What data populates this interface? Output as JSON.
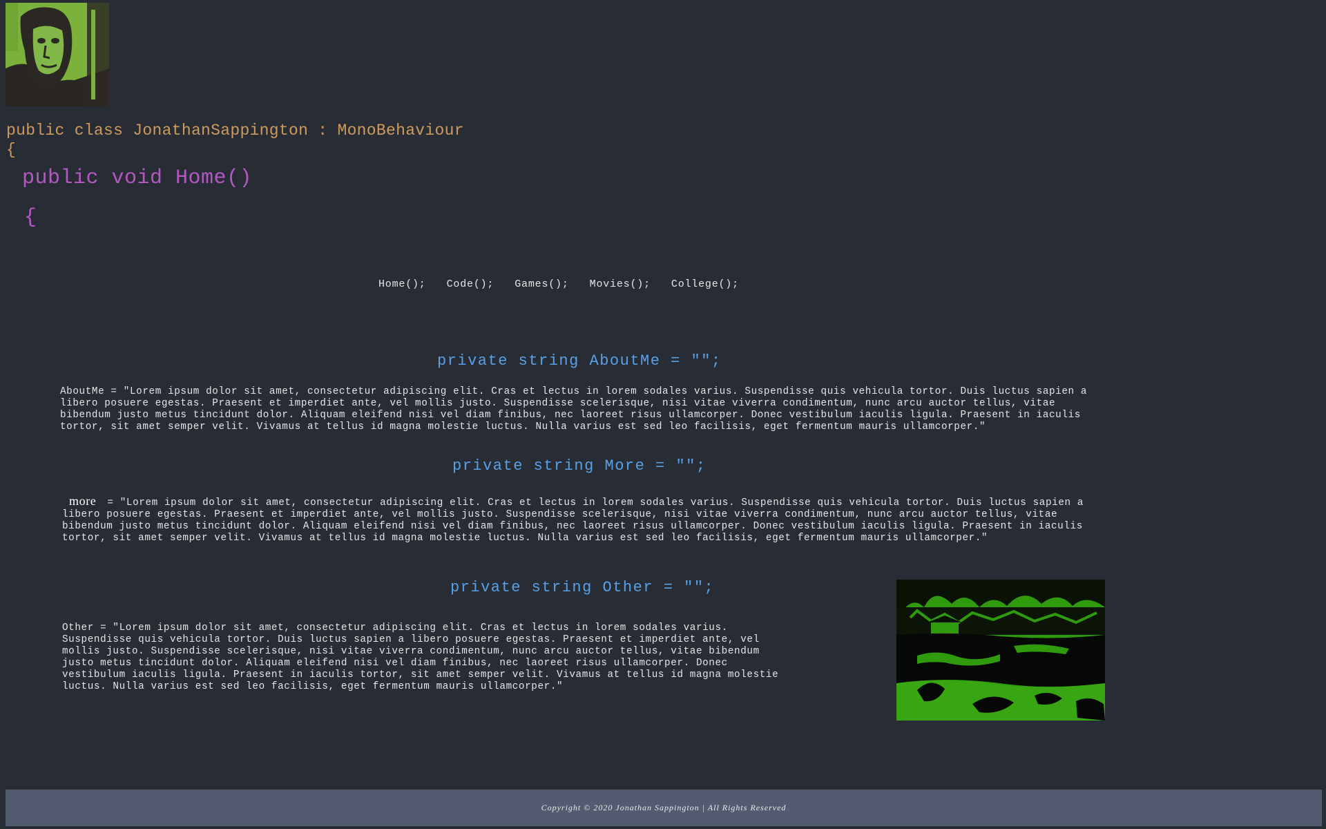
{
  "profile": {
    "avatar_icon": "portrait-photo-green"
  },
  "code": {
    "class_declaration": "public class JonathanSappington : MonoBehaviour",
    "class_open_brace": "{",
    "method_declaration": "public void Home()",
    "method_open_brace": "{"
  },
  "nav": {
    "items": [
      {
        "label": "Home();"
      },
      {
        "label": "Code();"
      },
      {
        "label": "Games();"
      },
      {
        "label": "Movies();"
      },
      {
        "label": "College();"
      }
    ]
  },
  "sections": {
    "about": {
      "heading": "private string AboutMe = \"\";",
      "text": "AboutMe = \"Lorem ipsum dolor sit amet, consectetur adipiscing elit. Cras et lectus in lorem sodales varius. Suspendisse quis vehicula tortor. Duis luctus sapien a libero posuere egestas. Praesent et imperdiet ante, vel mollis justo. Suspendisse scelerisque, nisi vitae viverra condimentum, nunc arcu auctor tellus, vitae bibendum justo metus tincidunt dolor. Aliquam eleifend nisi vel diam finibus, nec laoreet risus ullamcorper. Donec vestibulum iaculis ligula. Praesent in iaculis tortor, sit amet semper velit. Vivamus at tellus id magna molestie luctus. Nulla varius est sed leo facilisis, eget fermentum mauris ullamcorper.\""
    },
    "more": {
      "heading": "private string More = \"\";",
      "label": "more",
      "text": "= \"Lorem ipsum dolor sit amet, consectetur adipiscing elit. Cras et lectus in lorem sodales varius. Suspendisse quis vehicula tortor. Duis luctus sapien a libero posuere egestas. Praesent et imperdiet ante, vel mollis justo. Suspendisse scelerisque, nisi vitae viverra condimentum, nunc arcu auctor tellus, vitae bibendum justo metus tincidunt dolor. Aliquam eleifend nisi vel diam finibus, nec laoreet risus ullamcorper. Donec vestibulum iaculis ligula. Praesent in iaculis tortor, sit amet semper velit. Vivamus at tellus id magna molestie luctus. Nulla varius est sed leo facilisis, eget fermentum mauris ullamcorper.\""
    },
    "other": {
      "heading": "private string Other = \"\";",
      "text": "Other = \"Lorem ipsum dolor sit amet, consectetur adipiscing elit. Cras et lectus in lorem sodales varius. Suspendisse quis vehicula tortor. Duis luctus sapien a libero posuere egestas. Praesent et imperdiet ante, vel mollis justo. Suspendisse scelerisque, nisi vitae viverra condimentum, nunc arcu auctor tellus, vitae bibendum justo metus tincidunt dolor. Aliquam eleifend nisi vel diam finibus, nec laoreet risus ullamcorper. Donec vestibulum iaculis ligula. Praesent in iaculis tortor, sit amet semper velit. Vivamus at tellus id magna molestie luctus. Nulla varius est sed leo facilisis, eget fermentum mauris ullamcorper.\"",
      "image_icon": "park-pond-photo-green"
    }
  },
  "footer": {
    "copyright": "Copyright © 2020 Jonathan Sappington | All Rights Reserved"
  },
  "colors": {
    "background": "#272c35",
    "class_text": "#cf9a5b",
    "method_text": "#b658c3",
    "heading_text": "#5aa0e6",
    "footer_bg": "#525b70"
  }
}
